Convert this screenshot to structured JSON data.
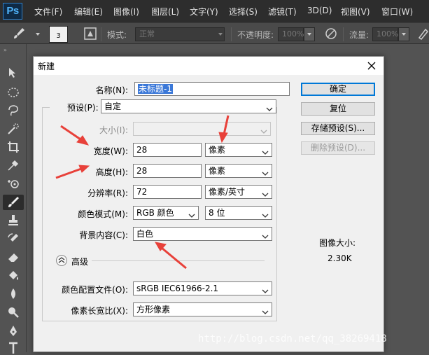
{
  "app": {
    "logo": "Ps",
    "menu": [
      "文件(F)",
      "编辑(E)",
      "图像(I)",
      "图层(L)",
      "文字(Y)",
      "选择(S)",
      "滤镜(T)",
      "3D(D)",
      "视图(V)",
      "窗口(W)"
    ]
  },
  "options_bar": {
    "brush_size": "3",
    "mode_label": "模式:",
    "mode_value": "正常",
    "opacity_label": "不透明度:",
    "opacity_value": "100%",
    "flow_label": "流量:",
    "flow_value": "100%"
  },
  "dialog": {
    "title": "新建",
    "name_label": "名称(N):",
    "name_value": "未标题-1",
    "preset_label": "预设(P):",
    "preset_value": "自定",
    "size_label": "大小(I):",
    "size_value": "",
    "width_label": "宽度(W):",
    "width_value": "28",
    "width_unit": "像素",
    "height_label": "高度(H):",
    "height_value": "28",
    "height_unit": "像素",
    "resolution_label": "分辨率(R):",
    "resolution_value": "72",
    "resolution_unit": "像素/英寸",
    "color_mode_label": "颜色模式(M):",
    "color_mode_value": "RGB 颜色",
    "bit_depth_value": "8 位",
    "background_label": "背景内容(C):",
    "background_value": "白色",
    "advanced_label": "高级",
    "color_profile_label": "颜色配置文件(O):",
    "color_profile_value": "sRGB IEC61966-2.1",
    "pixel_aspect_label": "像素长宽比(X):",
    "pixel_aspect_value": "方形像素",
    "buttons": {
      "ok": "确定",
      "reset": "复位",
      "save_preset": "存储预设(S)...",
      "delete_preset": "删除预设(D)..."
    },
    "image_size_label": "图像大小:",
    "image_size_value": "2.30K"
  },
  "watermark": "http://blog.csdn.net/qq_38269418",
  "colors": {
    "annotation_arrow": "#e8413a",
    "selection": "#3b78d8",
    "default_button_border": "#0078d7"
  }
}
